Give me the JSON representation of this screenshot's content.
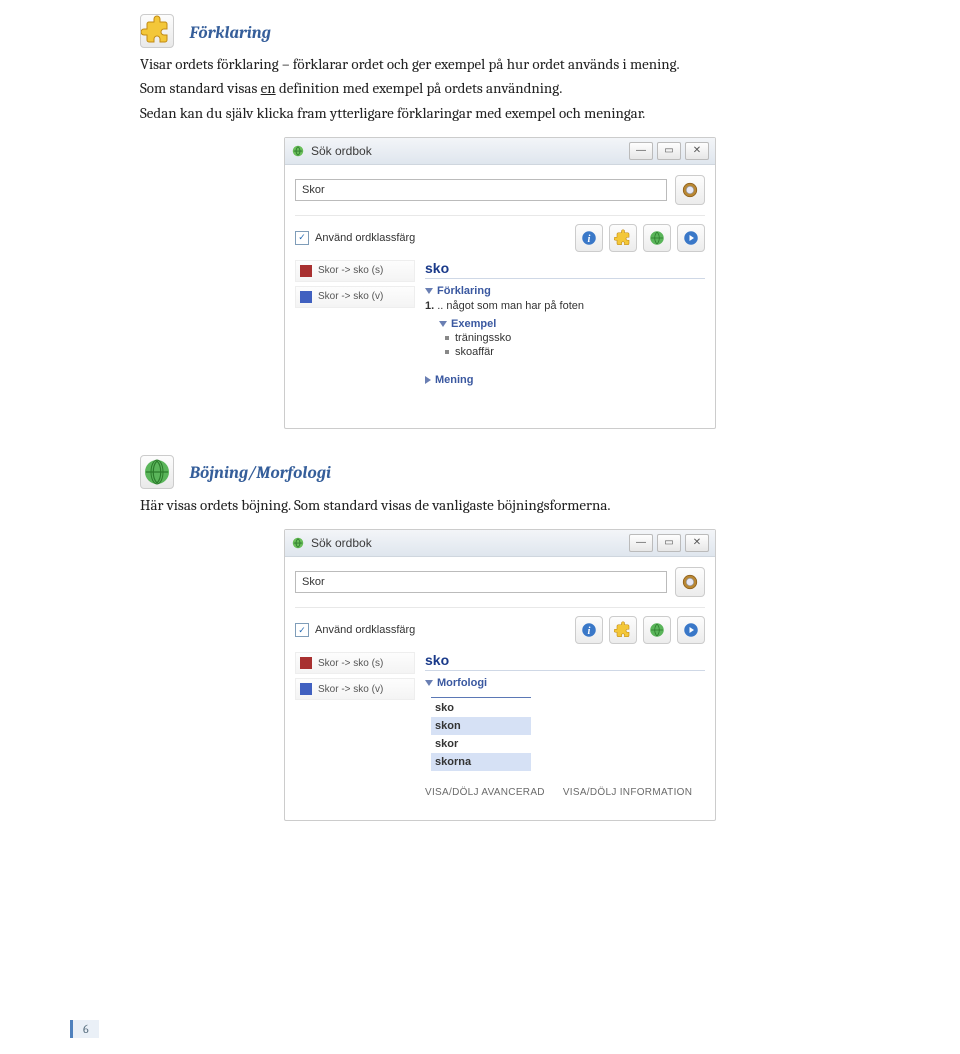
{
  "section1": {
    "heading": "Förklaring",
    "desc1": "Visar ordets förklaring – förklarar ordet och ger exempel på hur ordet används i mening.",
    "desc2_a": "Som standard visas ",
    "desc2_u": "en",
    "desc2_b": " definition med exempel på ordets användning.",
    "desc3": "Sedan kan du själv klicka fram ytterligare förklaringar med exempel och meningar."
  },
  "section2": {
    "heading": "Böjning/Morfologi",
    "desc": "Här visas ordets böjning. Som standard visas de vanligaste böjningsformerna."
  },
  "app": {
    "title": "Sök ordbok",
    "search_value": "Skor",
    "checkbox_label": "Använd ordklassfärg",
    "matches": [
      {
        "color": "red",
        "text": "Skor -> sko (s)"
      },
      {
        "color": "blue",
        "text": "Skor -> sko (v)"
      }
    ],
    "headword": "sko",
    "forklaring_label": "Förklaring",
    "def1_num": "1.",
    "def1_text": ".. något som man har på foten",
    "exempel_label": "Exempel",
    "examples": [
      "träningssko",
      "skoaffär"
    ],
    "mening_label": "Mening",
    "morfologi_label": "Morfologi",
    "morph_rows": [
      "sko",
      "skon",
      "skor",
      "skorna"
    ],
    "footer_advanced": "VISA/DÖLJ AVANCERAD",
    "footer_info": "VISA/DÖLJ INFORMATION"
  },
  "page_number": "6"
}
